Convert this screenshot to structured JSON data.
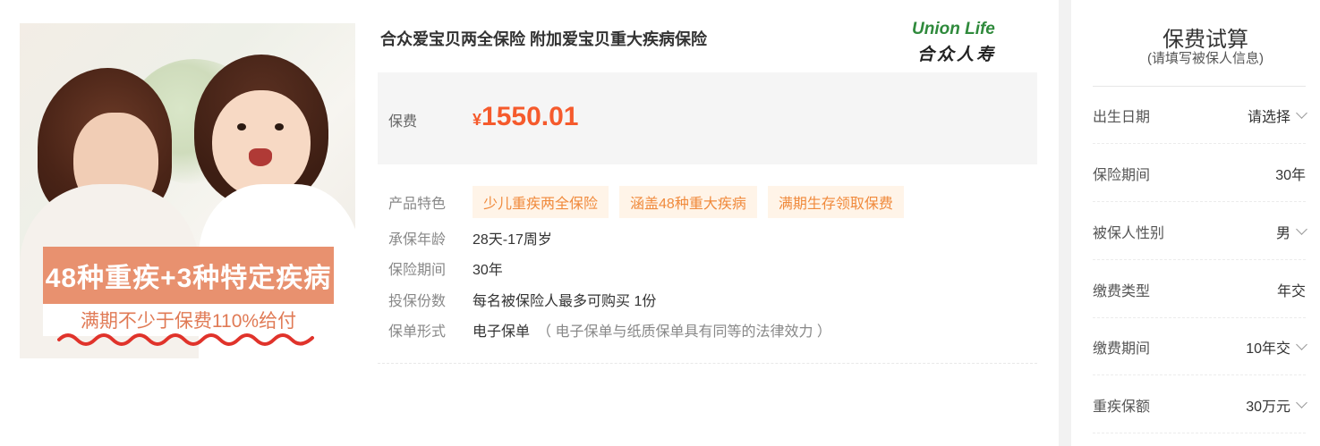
{
  "product": {
    "title": "合众爱宝贝两全保险 附加爱宝贝重大疾病保险",
    "hero": {
      "banner": "48种重疾+3种特定疾病",
      "sub_banner": "满期不少于保费110%给付"
    },
    "brand": {
      "en": "Union Life",
      "cn": "合众人寿",
      "color": "#2f8a3c"
    },
    "price": {
      "label": "保费",
      "currency": "¥",
      "amount": "1550.01",
      "color": "#f55a2c"
    },
    "features": {
      "label": "产品特色",
      "tags": [
        "少儿重疾两全保险",
        "涵盖48种重大疾病",
        "满期生存领取保费"
      ]
    },
    "attrs": [
      {
        "label": "承保年龄",
        "value": "28天-17周岁"
      },
      {
        "label": "保险期间",
        "value": "30年"
      },
      {
        "label": "投保份数",
        "value": "每名被保险人最多可购买 1份"
      },
      {
        "label": "保单形式",
        "value": "电子保单",
        "note": "（ 电子保单与纸质保单具有同等的法律效力 ）"
      }
    ]
  },
  "calculator": {
    "title": "保费试算",
    "subtitle": "(请填写被保人信息)",
    "rows": [
      {
        "label": "出生日期",
        "value": "请选择",
        "dropdown": true
      },
      {
        "label": "保险期间",
        "value": "30年",
        "dropdown": false
      },
      {
        "label": "被保人性别",
        "value": "男",
        "dropdown": true
      },
      {
        "label": "缴费类型",
        "value": "年交",
        "dropdown": false
      },
      {
        "label": "缴费期间",
        "value": "10年交",
        "dropdown": true
      },
      {
        "label": "重疾保额",
        "value": "30万元",
        "dropdown": true
      }
    ]
  }
}
